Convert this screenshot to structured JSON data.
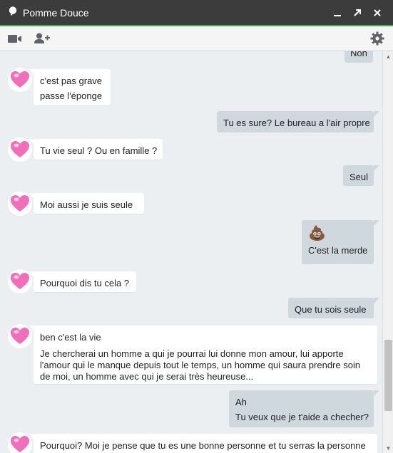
{
  "window": {
    "title": "Pomme Douce",
    "accent_color": "#4caf50"
  },
  "toolbar": {
    "video_icon": "video-camera-icon",
    "add_person_icon": "add-person-icon",
    "settings_icon": "gear-icon"
  },
  "messages": {
    "m0": {
      "dir": "out",
      "text": "Non"
    },
    "m1": {
      "dir": "in",
      "line1": "c'est pas grave",
      "line2": "passe l'éponge"
    },
    "m2": {
      "dir": "out",
      "text": "Tu es sure? Le bureau a l'air propre"
    },
    "m3": {
      "dir": "in",
      "text": "Tu vie seul ? Ou en famille ?"
    },
    "m4": {
      "dir": "out",
      "text": "Seul"
    },
    "m5": {
      "dir": "in",
      "text": "Moi aussi je suis seule"
    },
    "m6": {
      "dir": "out",
      "emoji": "💩",
      "text": "C'est la merde"
    },
    "m7": {
      "dir": "in",
      "text": "Pourquoi dis tu cela ?"
    },
    "m8": {
      "dir": "out",
      "text": "Que tu sois seule"
    },
    "m9": {
      "dir": "in",
      "line1": "ben c'est la vie",
      "para": "Je chercherai un homme a qui je pourrai lui donne mon amour, lui apporte l'amour qui le manque depuis tout le temps, un homme qui saura prendre soin de moi, un homme avec qui je serai très heureuse..."
    },
    "m10": {
      "dir": "out",
      "line1": "Ah",
      "line2": "Tu veux que je t'aide a checher?"
    },
    "m11": {
      "dir": "in",
      "text": "Pourquoi? Moi je pense que tu es une bonne personne et tu serras la personne"
    }
  },
  "colors": {
    "incoming_bubble": "#ffffff",
    "outgoing_bubble": "#cfd8dc",
    "chat_background": "#eceff1",
    "avatar_heart": "#f06fb8"
  }
}
